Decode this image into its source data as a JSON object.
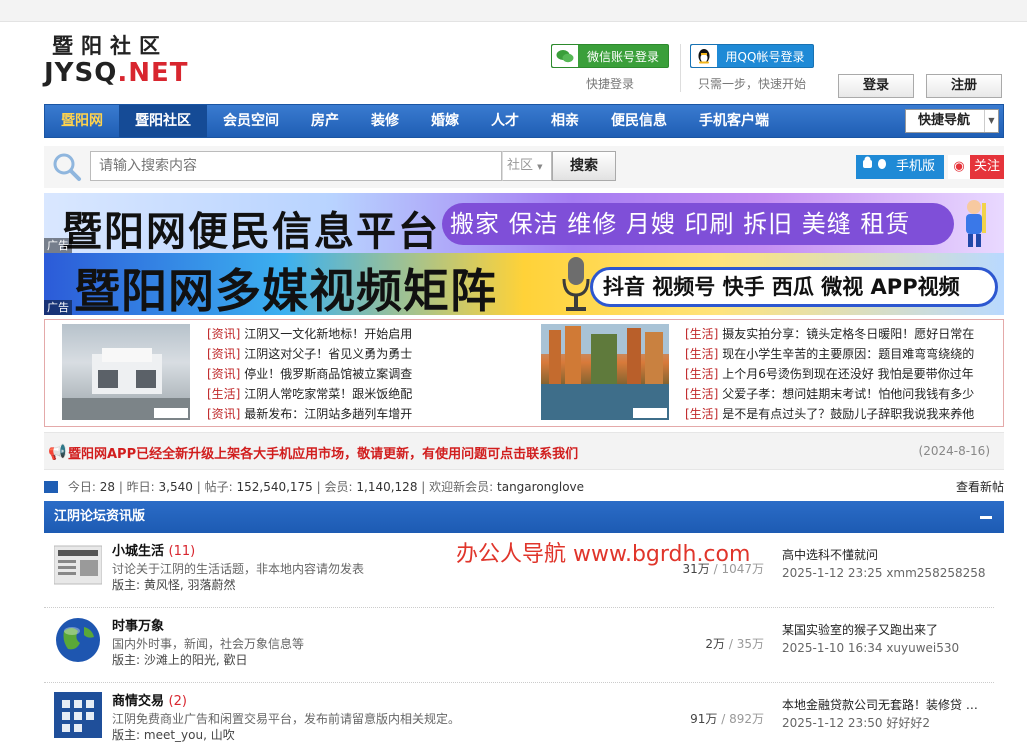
{
  "logo": {
    "cn": "暨阳社区",
    "en_part1": "JYSQ",
    "en_part2": ".NET"
  },
  "login": {
    "wechat_label": "微信账号登录",
    "wechat_hint": "快捷登录",
    "qq_label": "用QQ帐号登录",
    "qq_hint": "只需一步，快速开始",
    "login_button": "登录",
    "register_button": "注册"
  },
  "nav": {
    "items": [
      "暨阳网",
      "暨阳社区",
      "会员空间",
      "房产",
      "装修",
      "婚嫁",
      "人才",
      "相亲",
      "便民信息",
      "手机客户端"
    ],
    "active_index": 1,
    "quick_nav": "快捷导航"
  },
  "search": {
    "placeholder": "请输入搜索内容",
    "scope": "社区",
    "button": "搜索",
    "mobile_label": "手机版",
    "follow_label": "关注"
  },
  "banners": {
    "ad_tag": "广告",
    "banner1_title": "暨阳网便民信息平台",
    "banner1_services": "搬家 保洁 维修 月嫂 印刷  拆旧 美缝 租赁",
    "banner2_title": "暨阳网多媒视频矩阵",
    "banner2_platforms": "抖音 视频号 快手 西瓜 微视 APP视频"
  },
  "news": {
    "left": [
      {
        "tag": "[资讯]",
        "title": "江阴又一文化新地标！开始启用"
      },
      {
        "tag": "[资讯]",
        "title": "江阴这对父子！省见义勇为勇士"
      },
      {
        "tag": "[资讯]",
        "title": "停业！俄罗斯商品馆被立案调查"
      },
      {
        "tag": "[生活]",
        "title": "江阴人常吃家常菜！跟米饭绝配"
      },
      {
        "tag": "[资讯]",
        "title": "最新发布：江阴站多趟列车增开"
      }
    ],
    "right": [
      {
        "tag": "[生活]",
        "title": "摄友实拍分享：镜头定格冬日暖阳！愿好日常在"
      },
      {
        "tag": "[生活]",
        "title": "现在小学生辛苦的主要原因：题目难弯弯绕绕的"
      },
      {
        "tag": "[生活]",
        "title": "上个月6号烫伤到现在还没好  我怕是要带你过年"
      },
      {
        "tag": "[生活]",
        "title": "父爱子孝：想问娃期末考试！怕他问我钱有多少"
      },
      {
        "tag": "[生活]",
        "title": "是不是有点过头了？鼓励儿子辞职我说我来养他"
      }
    ]
  },
  "notice": {
    "text": "暨阳网APP已经全新升级上架各大手机应用市场，敬请更新，有使用问题可点击联系我们",
    "date": "(2024-8-16)"
  },
  "stats": {
    "today_label": "今日:",
    "today": "28",
    "yesterday_label": "昨日:",
    "yesterday": "3,540",
    "posts_label": "帖子:",
    "posts": "152,540,175",
    "members_label": "会员:",
    "members": "1,140,128",
    "newest_label": "欢迎新会员:",
    "newest": "tangaronglove",
    "view_new": "查看新帖"
  },
  "forum_section": {
    "title": "江阴论坛资讯版",
    "forums": [
      {
        "name": "小城生活",
        "count": "(11)",
        "desc": "讨论关于江阴的生活话题，非本地内容请勿发表",
        "mod_label": "版主:",
        "mods": "黄风怪, 羽落蔚然",
        "topics": "31万",
        "posts": "1047万",
        "last_title": "高中选科不懂就问",
        "last_meta": "2025-1-12 23:25 xmm258258258"
      },
      {
        "name": "时事万象",
        "count": "",
        "desc": "国内外时事，新闻，社会万象信息等",
        "mod_label": "版主:",
        "mods": "沙滩上的阳光, 歡日",
        "topics": "2万",
        "posts": "35万",
        "last_title": "某国实验室的猴子又跑出来了",
        "last_meta": "2025-1-10 16:34 xuyuwei530"
      },
      {
        "name": "商情交易",
        "count": "(2)",
        "desc": "江阴免费商业广告和闲置交易平台，发布前请留意版内相关规定。",
        "mod_label": "版主:",
        "mods": "meet_you, 山吹",
        "topics": "91万",
        "posts": "892万",
        "last_title": "本地金融贷款公司无套路！装修贷 …",
        "last_meta": "2025-1-12 23:50 好好好2"
      }
    ]
  },
  "watermark": "办公人导航  www.bgrdh.com",
  "colors": {
    "nav_blue": "#1f5eb4",
    "accent_red": "#d8262f",
    "wechat_green": "#3a9f3a",
    "qq_blue": "#1f8ad6"
  }
}
